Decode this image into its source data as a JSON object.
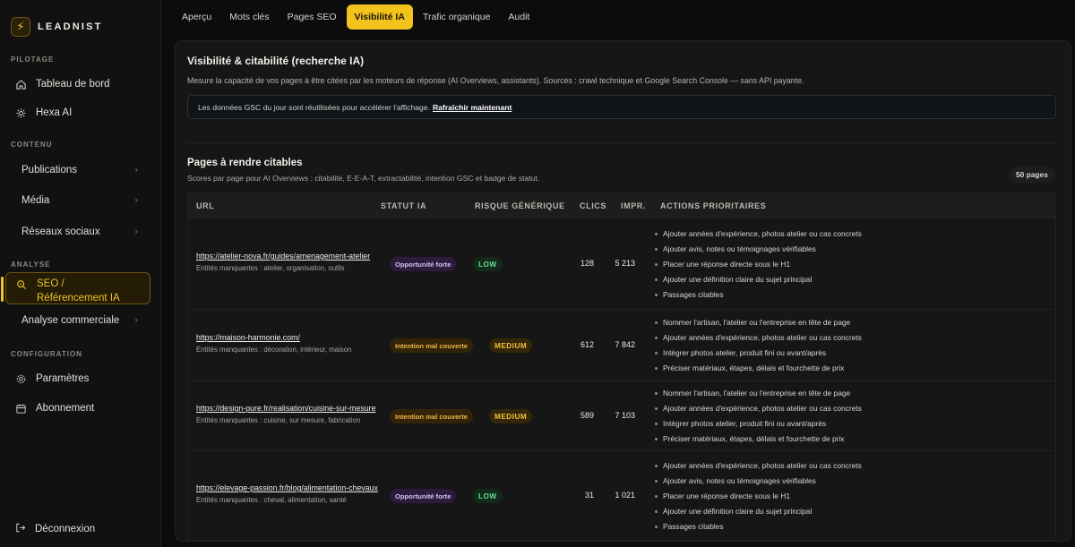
{
  "brand": {
    "name": "LEADNIST",
    "logo_icon": "lightning-bolt-icon"
  },
  "sidebar": {
    "sections": {
      "pilotage": "PILOTAGE",
      "contenu": "CONTENU",
      "analyse": "ANALYSE",
      "configuration": "CONFIGURATION"
    },
    "items": [
      {
        "label": "Tableau de bord",
        "icon": "home-icon"
      },
      {
        "label": "Hexa AI",
        "icon": "sparkle-icon"
      },
      {
        "label": "Publications",
        "icon": "chevron-right-icon"
      },
      {
        "label": "Média",
        "icon": "chevron-right-icon"
      },
      {
        "label": "Réseaux sociaux",
        "icon": "chevron-right-icon"
      },
      {
        "label": "SEO / Référencement IA",
        "icon": "search-icon"
      },
      {
        "label": "Analyse commerciale",
        "icon": "chevron-right-icon"
      },
      {
        "label": "Paramètres",
        "icon": "gear-icon"
      },
      {
        "label": "Abonnement",
        "icon": "calendar-icon"
      }
    ],
    "logout": "Déconnexion"
  },
  "tabs": [
    "Aperçu",
    "Mots clés",
    "Pages SEO",
    "Visibilité IA",
    "Trafic organique",
    "Audit"
  ],
  "active_tab": "Visibilité IA",
  "panel": {
    "title": "Visibilité & citabilité (recherche IA)",
    "description": "Mesure la capacité de vos pages à être citées par les moteurs de réponse (AI Overviews, assistants). Sources : crawl technique et Google Search Console — sans API payante.",
    "notice_text": "Les données GSC du jour sont réutilisées pour accélérer l'affichage.",
    "notice_link": "Rafraîchir maintenant",
    "section_title": "Pages à rendre citables",
    "section_desc": "Scores par page pour AI Overviews : citabilité, E-E-A-T, extractabilité, intention GSC et badge de statut.",
    "count_badge": "50 pages"
  },
  "table": {
    "headers": [
      "URL",
      "STATUT IA",
      "RISQUE GÉNÉRIQUE",
      "CLICS",
      "IMPR.",
      "ACTIONS PRIORITAIRES"
    ],
    "rows": [
      {
        "url": "https://atelier-nova.fr/guides/amenagement-atelier",
        "entities": "Entités manquantes : atelier, organisation, outils",
        "status": "Opportunité forte",
        "status_kind": "opp",
        "risk": "LOW",
        "risk_kind": "low",
        "clicks": "128",
        "impressions": "5 213",
        "actions": [
          "Ajouter années d'expérience, photos atelier ou cas concrets",
          "Ajouter avis, notes ou témoignages vérifiables",
          "Placer une réponse directe sous le H1",
          "Ajouter une définition claire du sujet principal",
          "Passages citables"
        ]
      },
      {
        "url": "https://maison-harmonie.com/",
        "entities": "Entités manquantes : décoration, intérieur, maison",
        "status": "Intention mal couverte",
        "status_kind": "int",
        "risk": "MEDIUM",
        "risk_kind": "med",
        "clicks": "612",
        "impressions": "7 842",
        "actions": [
          "Nommer l'artisan, l'atelier ou l'entreprise en tête de page",
          "Ajouter années d'expérience, photos atelier ou cas concrets",
          "Intégrer photos atelier, produit fini ou avant/après",
          "Préciser matériaux, étapes, délais et fourchette de prix"
        ]
      },
      {
        "url": "https://design-pure.fr/realisation/cuisine-sur-mesure",
        "entities": "Entités manquantes : cuisine, sur mesure, fabrication",
        "status": "Intention mal couverte",
        "status_kind": "int",
        "risk": "MEDIUM",
        "risk_kind": "med",
        "clicks": "589",
        "impressions": "7 103",
        "actions": [
          "Nommer l'artisan, l'atelier ou l'entreprise en tête de page",
          "Ajouter années d'expérience, photos atelier ou cas concrets",
          "Intégrer photos atelier, produit fini ou avant/après",
          "Préciser matériaux, étapes, délais et fourchette de prix"
        ]
      },
      {
        "url": "https://elevage-passion.fr/blog/alimentation-chevaux",
        "entities": "Entités manquantes : cheval, alimentation, santé",
        "status": "Opportunité forte",
        "status_kind": "opp",
        "risk": "LOW",
        "risk_kind": "low",
        "clicks": "31",
        "impressions": "1 021",
        "actions": [
          "Ajouter années d'expérience, photos atelier ou cas concrets",
          "Ajouter avis, notes ou témoignages vérifiables",
          "Placer une réponse directe sous le H1",
          "Ajouter une définition claire du sujet principal",
          "Passages citables"
        ]
      }
    ]
  }
}
